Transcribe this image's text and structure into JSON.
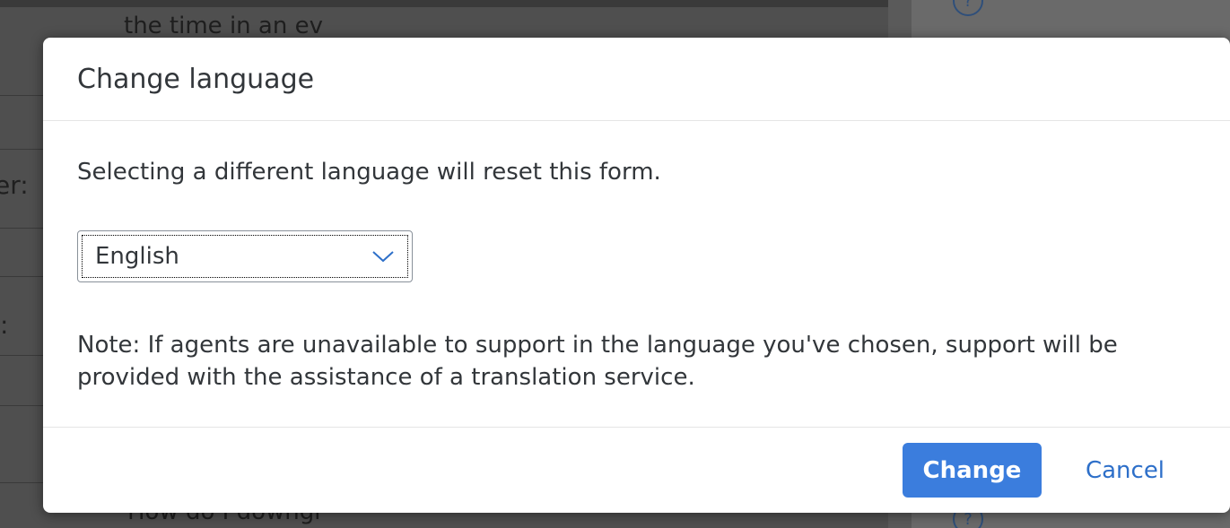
{
  "background": {
    "left_fragment": "er:",
    "colon_fragment": ":",
    "right_top_text": "the time in an ev",
    "right_bottom_text": "How do I downgr",
    "help_icon": "question-circle-icon"
  },
  "dialog": {
    "title": "Change language",
    "message": "Selecting a different language will reset this form.",
    "language_select": {
      "value": "English",
      "icon": "chevron-down-icon"
    },
    "note": "Note: If agents are unavailable to support in the language you've chosen, support will be provided with the assistance of a translation service.",
    "buttons": {
      "change_label": "Change",
      "cancel_label": "Cancel"
    }
  },
  "colors": {
    "primary": "#3b7ddd",
    "link": "#2d6fc9",
    "text": "#32363a"
  }
}
